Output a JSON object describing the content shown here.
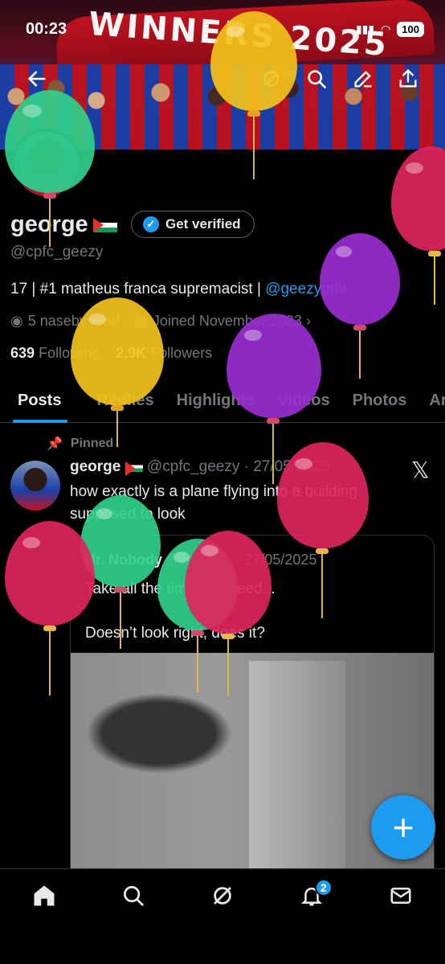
{
  "status_bar": {
    "time": "00:23",
    "battery": "100"
  },
  "banner": {
    "text": "WINNERS 2025"
  },
  "profile": {
    "name": "george",
    "verify_button": "Get verified",
    "handle": "@cpfc_geezy",
    "bio_text": "17 | #1 matheus franca supremacist | ",
    "bio_link": "@geezypriv",
    "location": "5 naseby road",
    "joined": "Joined November 2023",
    "following_count": "639",
    "following_label": "Following",
    "followers_count": "2.9K",
    "followers_label": "Followers"
  },
  "tabs": [
    "Posts",
    "Replies",
    "Highlights",
    "Videos",
    "Photos",
    "Ar"
  ],
  "post": {
    "pinned_label": "Pinned",
    "author": "george",
    "meta": "@cpfc_geezy · 27/05/2025",
    "text": "how exactly is a plane flying into a building supposed to look",
    "quote": {
      "author": "Mr. Nobody",
      "meta": "@Mmist... · 27/05/2025",
      "line1": "Take all the time you need...",
      "line2": "Doesn’t look right, does it?"
    }
  },
  "nav": {
    "notifications_badge": "2"
  },
  "colors": {
    "accent": "#1d9bf0",
    "background": "#000000",
    "muted": "#71767b"
  },
  "icons": [
    "back-icon",
    "grok-icon",
    "search-icon",
    "edit-icon",
    "share-icon",
    "location-icon",
    "calendar-icon",
    "pin-icon",
    "x-logo-icon",
    "home-icon",
    "notifications-icon",
    "mail-icon",
    "compose-icon"
  ]
}
